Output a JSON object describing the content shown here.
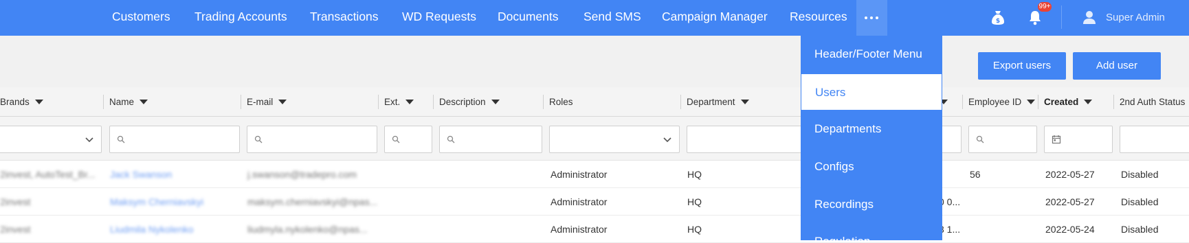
{
  "nav": {
    "items": [
      "Customers",
      "Trading Accounts",
      "Transactions",
      "WD Requests",
      "Documents",
      "Send SMS",
      "Campaign Manager",
      "Resources"
    ],
    "notification_badge": "99+",
    "user_name": "Super Admin"
  },
  "toolbar": {
    "export_label": "Export users",
    "add_label": "Add user"
  },
  "dropdown_menu": {
    "items": [
      "Header/Footer Menu",
      "Users",
      "Departments",
      "Configs",
      "Recordings",
      "Regulation"
    ],
    "active_item": "Users"
  },
  "table": {
    "columns": [
      "Brands",
      "Name",
      "E-mail",
      "Ext.",
      "Description",
      "Roles",
      "Department",
      "Employee ID",
      "Created",
      "2nd Auth Status"
    ],
    "rows": [
      {
        "brands": "2invest, AutoTest_Br...",
        "name": "Jack Swanson",
        "email": "j.swanson@tradepro.com",
        "ext": "",
        "description": "",
        "roles": "Administrator",
        "department": "HQ",
        "hidden": "",
        "employee_id": "56",
        "created": "2022-05-27",
        "auth": "Disabled"
      },
      {
        "brands": "2invest",
        "name": "Maksym Cherniavskyi",
        "email": "maksym.cherniavskyi@npas...",
        "ext": "",
        "description": "",
        "roles": "Administrator",
        "department": "HQ",
        "hidden": "0 0...",
        "employee_id": "",
        "created": "2022-05-27",
        "auth": "Disabled"
      },
      {
        "brands": "2invest",
        "name": "Liudmila Nykolenko",
        "email": "liudmyla.nykolenko@npas...",
        "ext": "",
        "description": "",
        "roles": "Administrator",
        "department": "HQ",
        "hidden": "3 1...",
        "employee_id": "",
        "created": "2022-05-24",
        "auth": "Disabled"
      }
    ]
  },
  "colors": {
    "brand_blue": "#4285f4",
    "header_bg": "#f4f4f4",
    "toolbar_bg": "#f1f1f1"
  }
}
